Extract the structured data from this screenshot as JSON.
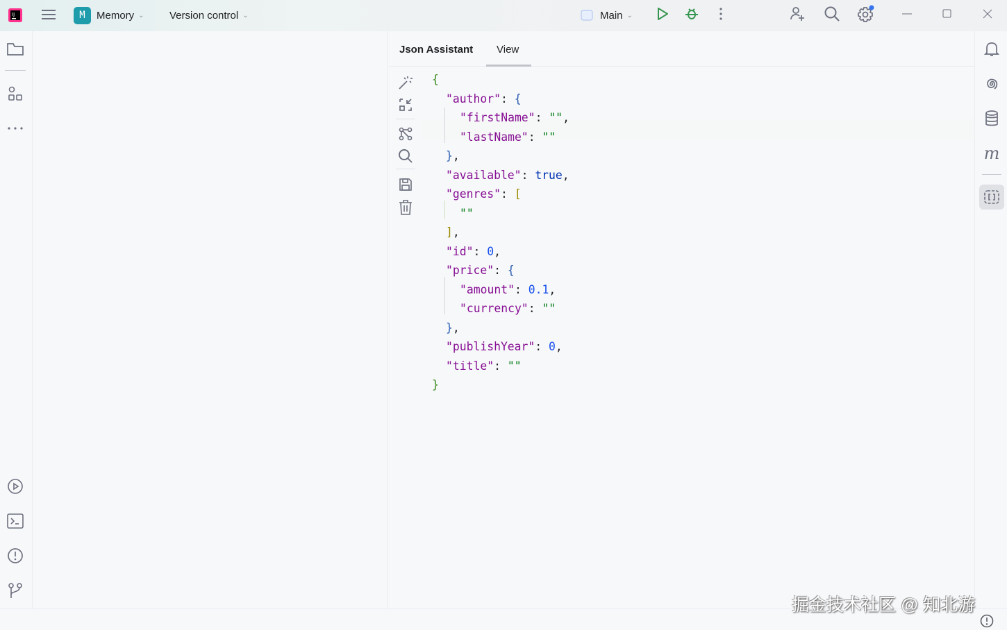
{
  "titlebar": {
    "project_initial": "M",
    "project_name": "Memory",
    "vcs_label": "Version control",
    "run_config": "Main"
  },
  "tool_window": {
    "tabs": [
      {
        "label": "Json Assistant",
        "active": false
      },
      {
        "label": "View",
        "active": true
      }
    ],
    "toolbar_icons": [
      "magic-wand-icon",
      "collapse-icon",
      "graph-icon",
      "search-icon",
      "save-icon",
      "trash-icon"
    ]
  },
  "json_view": {
    "lines": [
      {
        "indent": 0,
        "tokens": [
          [
            "{",
            "g1"
          ]
        ]
      },
      {
        "indent": 1,
        "tokens": [
          [
            "\"author\"",
            "k"
          ],
          [
            ": ",
            "p"
          ],
          [
            "{",
            "g2"
          ]
        ]
      },
      {
        "indent": 2,
        "tokens": [
          [
            "\"firstName\"",
            "k"
          ],
          [
            ": ",
            "p"
          ],
          [
            "\"\"",
            "s"
          ],
          [
            ",",
            "p"
          ]
        ]
      },
      {
        "indent": 2,
        "tokens": [
          [
            "\"lastName\"",
            "k"
          ],
          [
            ": ",
            "p"
          ],
          [
            "\"\"",
            "s"
          ]
        ]
      },
      {
        "indent": 1,
        "tokens": [
          [
            "}",
            "g2"
          ],
          [
            ",",
            "p"
          ]
        ]
      },
      {
        "indent": 1,
        "tokens": [
          [
            "\"available\"",
            "k"
          ],
          [
            ": ",
            "p"
          ],
          [
            "true",
            "b"
          ],
          [
            ",",
            "p"
          ]
        ]
      },
      {
        "indent": 1,
        "tokens": [
          [
            "\"genres\"",
            "k"
          ],
          [
            ": ",
            "p"
          ],
          [
            "[",
            "g3"
          ]
        ]
      },
      {
        "indent": 2,
        "tokens": [
          [
            "\"\"",
            "s"
          ]
        ]
      },
      {
        "indent": 1,
        "tokens": [
          [
            "]",
            "g3"
          ],
          [
            ",",
            "p"
          ]
        ]
      },
      {
        "indent": 1,
        "tokens": [
          [
            "\"id\"",
            "k"
          ],
          [
            ": ",
            "p"
          ],
          [
            "0",
            "n"
          ],
          [
            ",",
            "p"
          ]
        ]
      },
      {
        "indent": 1,
        "tokens": [
          [
            "\"price\"",
            "k"
          ],
          [
            ": ",
            "p"
          ],
          [
            "{",
            "g2"
          ]
        ]
      },
      {
        "indent": 2,
        "tokens": [
          [
            "\"amount\"",
            "k"
          ],
          [
            ": ",
            "p"
          ],
          [
            "0.1",
            "n"
          ],
          [
            ",",
            "p"
          ]
        ]
      },
      {
        "indent": 2,
        "tokens": [
          [
            "\"currency\"",
            "k"
          ],
          [
            ": ",
            "p"
          ],
          [
            "\"\"",
            "s"
          ]
        ]
      },
      {
        "indent": 1,
        "tokens": [
          [
            "}",
            "g2"
          ],
          [
            ",",
            "p"
          ]
        ]
      },
      {
        "indent": 1,
        "tokens": [
          [
            "\"publishYear\"",
            "k"
          ],
          [
            ": ",
            "p"
          ],
          [
            "0",
            "n"
          ],
          [
            ",",
            "p"
          ]
        ]
      },
      {
        "indent": 1,
        "tokens": [
          [
            "\"title\"",
            "k"
          ],
          [
            ": ",
            "p"
          ],
          [
            "\"\"",
            "s"
          ]
        ]
      },
      {
        "indent": 0,
        "tokens": [
          [
            "}",
            "g1"
          ]
        ]
      }
    ]
  },
  "watermark": "掘金技术社区 @ 知北游",
  "colors": {
    "accent": "#3574f0",
    "project_badge": "#1e9cab",
    "run": "#369650"
  }
}
